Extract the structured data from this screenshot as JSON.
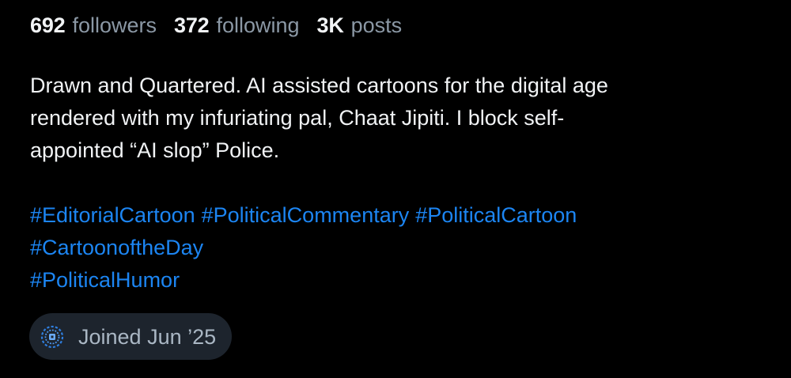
{
  "stats": [
    {
      "count": "692",
      "label": "followers"
    },
    {
      "count": "372",
      "label": "following"
    },
    {
      "count": "3K",
      "label": "posts"
    }
  ],
  "bio": "Drawn and Quartered. AI assisted cartoons for the digital age\nrendered with my infuriating pal, Chaat Jipiti. I block self-\nappointed “AI slop” Police.",
  "hashtags": [
    [
      "#EditorialCartoon",
      "#PoliticalCommentary",
      "#PoliticalCartoon"
    ],
    [
      "#CartoonoftheDay"
    ],
    [
      "#PoliticalHumor"
    ]
  ],
  "joined": {
    "label": "Joined Jun ’25",
    "icon": "starter-pack-icon"
  },
  "colors": {
    "background": "#000000",
    "text": "#f1f3f5",
    "muted": "#8b98a5",
    "link": "#1c85f2",
    "badge_bg": "#1d242d",
    "icon_blue": "#2f7fe0"
  }
}
